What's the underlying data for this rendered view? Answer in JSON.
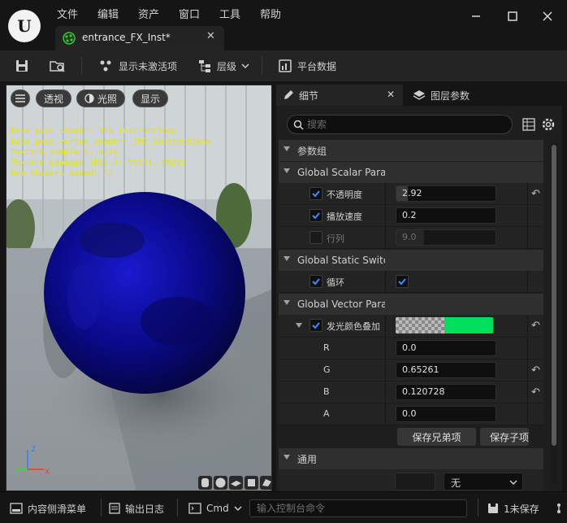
{
  "menu": [
    "文件",
    "编辑",
    "资产",
    "窗口",
    "工具",
    "帮助"
  ],
  "tab": {
    "title": "entrance_FX_Inst*"
  },
  "toolbar": {
    "show_inactive": "显示未激活项",
    "hierarchy": "层级",
    "platform": "平台数据"
  },
  "viewport": {
    "buttons": {
      "perspective": "透视",
      "lit": "光照",
      "show": "显示"
    },
    "stats": [
      "Base pass shader: 155 instructions",
      "Base pass vertex shader: 302 instructions",
      "Texture samplers: 4/16",
      "Texture Lookups (Est.): VS(3), PS(2)",
      "Num shaders added: 52"
    ],
    "axes": {
      "x": "X",
      "y": "Y",
      "z": "Z"
    }
  },
  "details": {
    "tab_details": "细节",
    "tab_layers": "图层参数",
    "search_placeholder": "搜索",
    "param_groups": "参数组",
    "scalar_group": "Global Scalar Parameter Values",
    "static_group": "Global Static Switch Parameter Values",
    "vector_group": "Global Vector Parameter Values",
    "general_group": "通用",
    "scalars": [
      {
        "name": "不透明度",
        "value": "2.92",
        "checked": true,
        "reset": true
      },
      {
        "name": "播放速度",
        "value": "0.2",
        "checked": true,
        "reset": false
      },
      {
        "name": "行列",
        "value": "9.0",
        "checked": false,
        "reset": false
      }
    ],
    "switch": {
      "name": "循环",
      "checked": true,
      "value_checked": true
    },
    "color": {
      "name": "发光颜色叠加",
      "checked": true,
      "swatch": "#00e05a"
    },
    "channels": [
      {
        "name": "R",
        "value": "0.0",
        "reset": false
      },
      {
        "name": "G",
        "value": "0.65261",
        "reset": true
      },
      {
        "name": "B",
        "value": "0.120728",
        "reset": true
      },
      {
        "name": "A",
        "value": "0.0",
        "reset": false
      }
    ],
    "save_siblings": "保存兄弟项",
    "save_children": "保存子项",
    "general_select": "无"
  },
  "statusbar": {
    "content_drawer": "内容侧滑菜单",
    "output_log": "输出日志",
    "cmd": "Cmd",
    "console_placeholder": "输入控制台命令",
    "unsaved": "1未保存"
  },
  "colors": {
    "accent_check": "#1f6feb",
    "stats_text": "#e6e600",
    "emissive": "#00e05a"
  }
}
